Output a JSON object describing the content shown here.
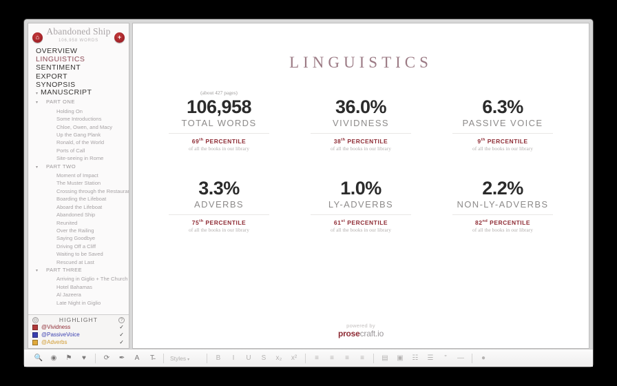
{
  "sidebar": {
    "book_title": "Abandoned Ship",
    "word_count": "106,958 WORDS",
    "home_icon": "home-icon",
    "add_icon": "plus-icon",
    "nav": [
      {
        "label": "OVERVIEW",
        "active": false
      },
      {
        "label": "LINGUISTICS",
        "active": true
      },
      {
        "label": "SENTIMENT",
        "active": false
      },
      {
        "label": "EXPORT",
        "active": false
      },
      {
        "label": "SYNOPSIS",
        "active": false
      }
    ],
    "tree": [
      {
        "label": "MANUSCRIPT",
        "level": 0,
        "disc": true
      },
      {
        "label": "PART ONE",
        "level": 1,
        "disc": true
      },
      {
        "label": "Holding On",
        "level": 2,
        "disc": false
      },
      {
        "label": "Some Introductions",
        "level": 2,
        "disc": false
      },
      {
        "label": "Chloe, Owen, and Macy",
        "level": 2,
        "disc": false
      },
      {
        "label": "Up the Gang Plank",
        "level": 2,
        "disc": false
      },
      {
        "label": "Ronald, of the World",
        "level": 2,
        "disc": false
      },
      {
        "label": "Ports of Call",
        "level": 2,
        "disc": false
      },
      {
        "label": "Site-seeing in Rome",
        "level": 2,
        "disc": false
      },
      {
        "label": "PART TWO",
        "level": 1,
        "disc": true
      },
      {
        "label": "Moment of Impact",
        "level": 2,
        "disc": false
      },
      {
        "label": "The Muster Station",
        "level": 2,
        "disc": false
      },
      {
        "label": "Crossing through the Restaurant",
        "level": 2,
        "disc": false
      },
      {
        "label": "Boarding the Lifeboat",
        "level": 2,
        "disc": false
      },
      {
        "label": "Aboard the Lifeboat",
        "level": 2,
        "disc": false
      },
      {
        "label": "Abandoned Ship",
        "level": 2,
        "disc": false
      },
      {
        "label": "Reunited",
        "level": 2,
        "disc": false
      },
      {
        "label": "Over the Railing",
        "level": 2,
        "disc": false
      },
      {
        "label": "Saying Goodbye",
        "level": 2,
        "disc": false
      },
      {
        "label": "Driving Off a Cliff",
        "level": 2,
        "disc": false
      },
      {
        "label": "Waiting to be Saved",
        "level": 2,
        "disc": false
      },
      {
        "label": "Rescued at Last",
        "level": 2,
        "disc": false
      },
      {
        "label": "PART THREE",
        "level": 1,
        "disc": true
      },
      {
        "label": "Arriving in Giglio + The Church",
        "level": 2,
        "disc": false
      },
      {
        "label": "Hotel Bahamas",
        "level": 2,
        "disc": false
      },
      {
        "label": "Al Jazeera",
        "level": 2,
        "disc": false
      },
      {
        "label": "Late Night in Giglio",
        "level": 2,
        "disc": false
      }
    ],
    "highlight": {
      "title": "HIGHLIGHT",
      "settings_icon": "target-icon",
      "help_icon": "help-icon",
      "items": [
        {
          "label": "@Vividness",
          "color": "#b03a3a",
          "text_color": "#8e2b34",
          "checked": "✓"
        },
        {
          "label": "@PassiveVoice",
          "color": "#3a3fb0",
          "text_color": "#3a3fb0",
          "checked": "✓"
        },
        {
          "label": "@Adverbs",
          "color": "#e0a93c",
          "text_color": "#d19a2e",
          "checked": "✓"
        }
      ]
    }
  },
  "main": {
    "title": "LINGUISTICS",
    "stats": [
      {
        "pages": "(about 427 pages)",
        "value": "106,958",
        "label": "TOTAL WORDS",
        "percentile_num": "69",
        "percentile_suffix": "th",
        "percentile_word": "PERCENTILE",
        "sub": "of all the books in our library"
      },
      {
        "pages": "",
        "value": "36.0%",
        "label": "VIVIDNESS",
        "percentile_num": "38",
        "percentile_suffix": "th",
        "percentile_word": "PERCENTILE",
        "sub": "of all the books in our library"
      },
      {
        "pages": "",
        "value": "6.3%",
        "label": "PASSIVE VOICE",
        "percentile_num": "9",
        "percentile_suffix": "th",
        "percentile_word": "PERCENTILE",
        "sub": "of all the books in our library"
      },
      {
        "pages": "",
        "value": "3.3%",
        "label": "ADVERBS",
        "percentile_num": "75",
        "percentile_suffix": "th",
        "percentile_word": "PERCENTILE",
        "sub": "of all the books in our library"
      },
      {
        "pages": "",
        "value": "1.0%",
        "label": "LY-ADVERBS",
        "percentile_num": "61",
        "percentile_suffix": "st",
        "percentile_word": "PERCENTILE",
        "sub": "of all the books in our library"
      },
      {
        "pages": "",
        "value": "2.2%",
        "label": "NON-LY-ADVERBS",
        "percentile_num": "82",
        "percentile_suffix": "nd",
        "percentile_word": "PERCENTILE",
        "sub": "of all the books in our library"
      }
    ],
    "footer": {
      "powered_by": "powered by",
      "brand_bold": "prose",
      "brand_rest": "craft.io"
    }
  },
  "toolbar": {
    "groups": [
      [
        {
          "icon": "🔍",
          "name": "search-icon",
          "dim": true
        },
        {
          "icon": "◉",
          "name": "eye-icon",
          "dim": false
        },
        {
          "icon": "⚑",
          "name": "flag-icon",
          "dim": false
        },
        {
          "icon": "♥",
          "name": "heart-icon",
          "dim": false
        }
      ],
      [
        {
          "icon": "⟳",
          "name": "refresh-icon",
          "dim": false
        },
        {
          "icon": "✒",
          "name": "pen-icon",
          "dim": false
        },
        {
          "icon": "A",
          "name": "font-color-icon",
          "dim": false
        },
        {
          "icon": "T̵",
          "name": "text-format-icon",
          "dim": false
        }
      ],
      [
        {
          "icon": "B",
          "name": "bold-icon",
          "dim": true
        },
        {
          "icon": "I",
          "name": "italic-icon",
          "dim": true
        },
        {
          "icon": "U",
          "name": "underline-icon",
          "dim": true
        },
        {
          "icon": "S",
          "name": "strikethrough-icon",
          "dim": true
        },
        {
          "icon": "x₂",
          "name": "subscript-icon",
          "dim": true
        },
        {
          "icon": "x²",
          "name": "superscript-icon",
          "dim": true
        }
      ],
      [
        {
          "icon": "≡",
          "name": "align-left-icon",
          "dim": true
        },
        {
          "icon": "≡",
          "name": "align-center-icon",
          "dim": true
        },
        {
          "icon": "≡",
          "name": "align-right-icon",
          "dim": true
        },
        {
          "icon": "≡",
          "name": "align-justify-icon",
          "dim": true
        }
      ],
      [
        {
          "icon": "▤",
          "name": "indent-icon",
          "dim": true
        },
        {
          "icon": "▣",
          "name": "outdent-icon",
          "dim": true
        },
        {
          "icon": "☷",
          "name": "bulleted-list-icon",
          "dim": true
        },
        {
          "icon": "☰",
          "name": "numbered-list-icon",
          "dim": true
        },
        {
          "icon": "”",
          "name": "blockquote-icon",
          "dim": true
        },
        {
          "icon": "—",
          "name": "horizontal-rule-icon",
          "dim": true
        }
      ],
      [
        {
          "icon": "●",
          "name": "comment-icon",
          "dim": true
        }
      ]
    ],
    "styles_label": "Styles",
    "styles_caret": "▾"
  }
}
